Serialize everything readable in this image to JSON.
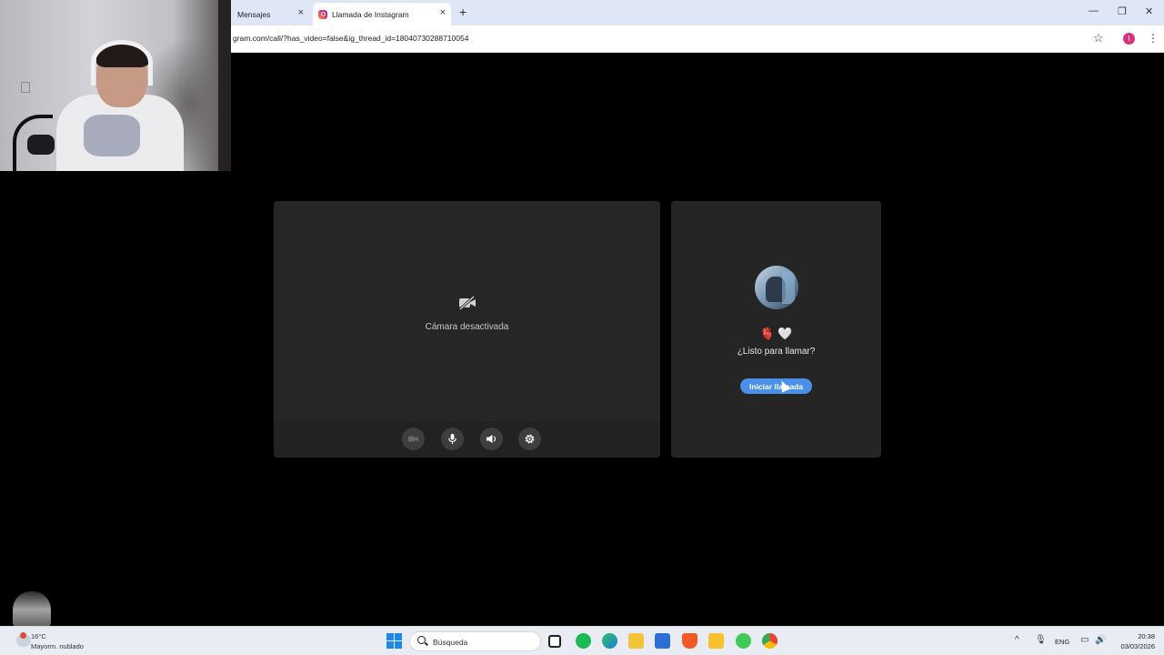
{
  "browser": {
    "tabs": [
      {
        "label": "Mensajes",
        "active": false
      },
      {
        "label": "Llamada de Instagram",
        "active": true
      }
    ],
    "new_tab_symbol": "+",
    "close_symbol": "×",
    "url": "gram.com/call/?has_video=false&ig_thread_id=18040730288710054",
    "profile_initial": "I",
    "window_controls": {
      "minimize": "—",
      "restore": "❐",
      "close": "✕"
    },
    "bookmark_symbol": "☆",
    "menu_symbol": "⋮"
  },
  "call": {
    "self_panel": {
      "camera_off_label": "Cámara desactivada",
      "camera_off_icon": "video-off-icon",
      "controls": [
        {
          "name": "camera-toggle",
          "icon": "video-camera-icon"
        },
        {
          "name": "microphone-toggle",
          "icon": "microphone-icon"
        },
        {
          "name": "speaker-toggle",
          "icon": "speaker-icon"
        },
        {
          "name": "settings",
          "icon": "gear-icon"
        }
      ]
    },
    "remote_panel": {
      "emojis": "🫀 🤍",
      "ready_text": "¿Listo para llamar?",
      "start_button_label": "Iniciar llamada"
    }
  },
  "taskbar": {
    "weather_temp": "16°C",
    "weather_desc": "Mayorm. nublado",
    "search_placeholder": "Búsqueda",
    "language": "ENG",
    "time": "20:38",
    "date": "03/03/2026",
    "colors": {
      "accent": "#4a90e8",
      "taskbar": "#e9edf3"
    }
  }
}
